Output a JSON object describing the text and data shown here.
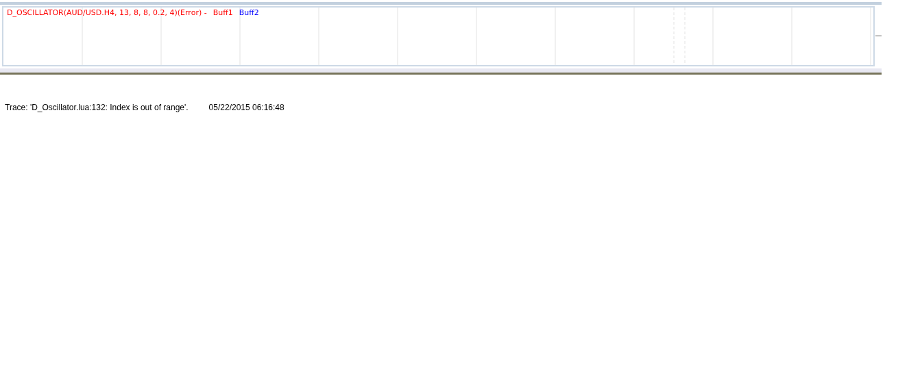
{
  "chart_panel": {
    "title": "D_OSCILLATOR(AUD/USD.H4, 13, 8, 8, 0.2, 4)(Error) -",
    "legend": [
      {
        "label": "Buff1",
        "color": "#ff0000"
      },
      {
        "label": "Buff2",
        "color": "#0000ff"
      }
    ]
  },
  "log": [
    {
      "message": "Trace: 'D_Oscillator.lua:132: Index is out of range'.",
      "time": "05/22/2015 06:16:48"
    }
  ]
}
